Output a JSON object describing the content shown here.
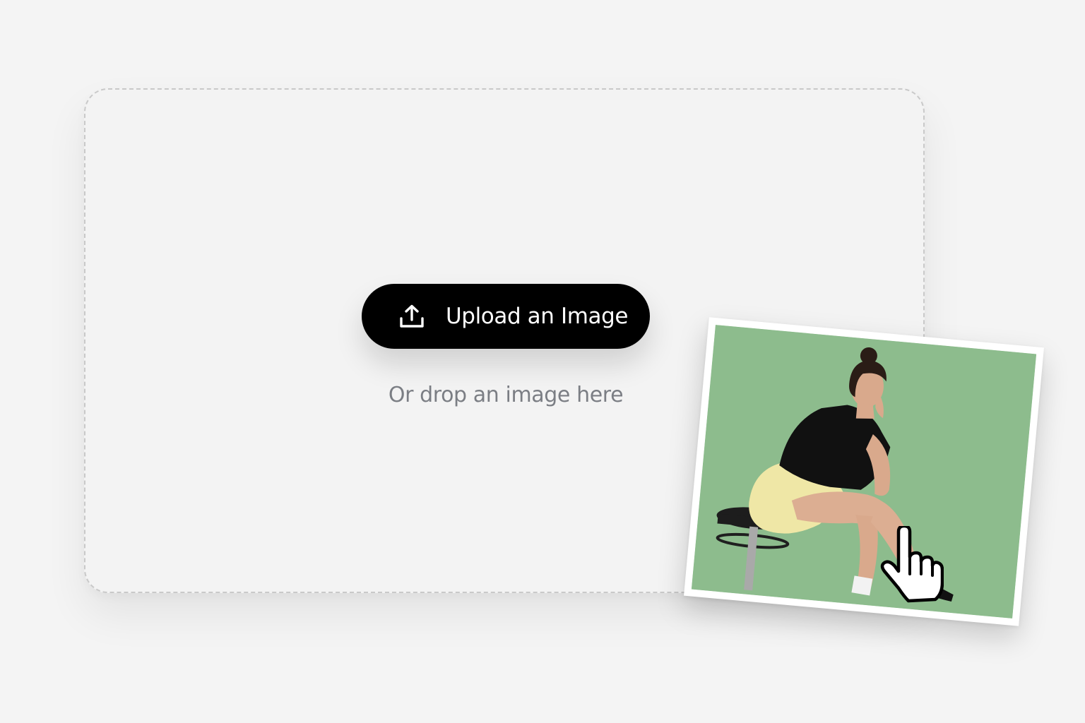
{
  "upload": {
    "button_label": "Upload an Image",
    "icon": "upload-icon",
    "hint": "Or drop an image here"
  },
  "preview": {
    "icon": "hand-pointer-cursor-icon",
    "background_color": "#8dbc8d"
  },
  "colors": {
    "page_background": "#f4f4f4",
    "button_background": "#000000",
    "button_text": "#ffffff",
    "hint_text": "#7b7e84",
    "dropzone_border": "#c9c9c9"
  }
}
